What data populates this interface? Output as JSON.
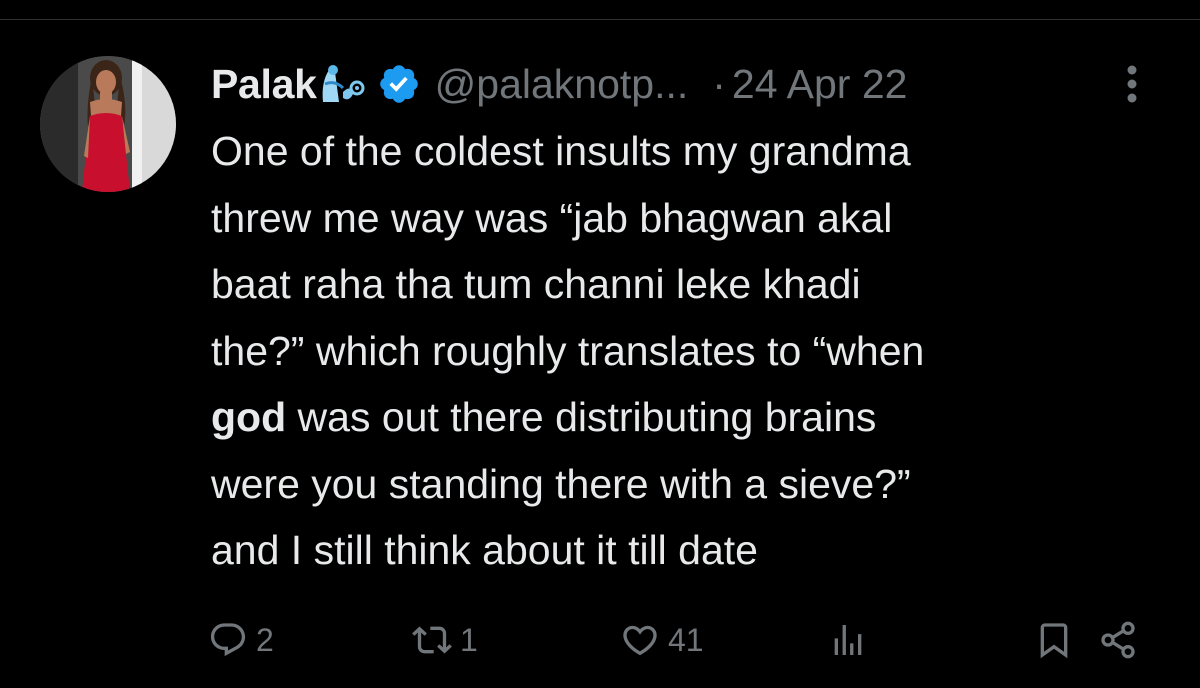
{
  "tweet": {
    "author": {
      "display_name": "Palak",
      "name_emoji": "genie-emoji",
      "verified": true,
      "handle": "@palaknotp...",
      "avatar": "profile-photo"
    },
    "separator": "·",
    "date": "24 Apr 22",
    "text_lines": [
      "One of the coldest insults my grandma",
      "threw me way was “jab bhagwan akal",
      "baat raha tha tum channi leke khadi",
      "the?” which roughly translates to “when",
      {
        "bold": "god",
        "rest": " was out there distributing brains"
      },
      "were you standing there with a sieve?”",
      "and I still think about it till date"
    ],
    "actions": {
      "reply": {
        "icon": "reply-icon",
        "count": "2"
      },
      "retweet": {
        "icon": "retweet-icon",
        "count": "1"
      },
      "like": {
        "icon": "heart-icon",
        "count": "41"
      },
      "views": {
        "icon": "views-icon"
      },
      "bookmark": {
        "icon": "bookmark-icon"
      },
      "share": {
        "icon": "share-icon"
      }
    }
  },
  "colors": {
    "background": "#000000",
    "text": "#e7e9ea",
    "muted": "#71767b",
    "verified_blue": "#1d9bf0",
    "divider": "#2f3336"
  }
}
